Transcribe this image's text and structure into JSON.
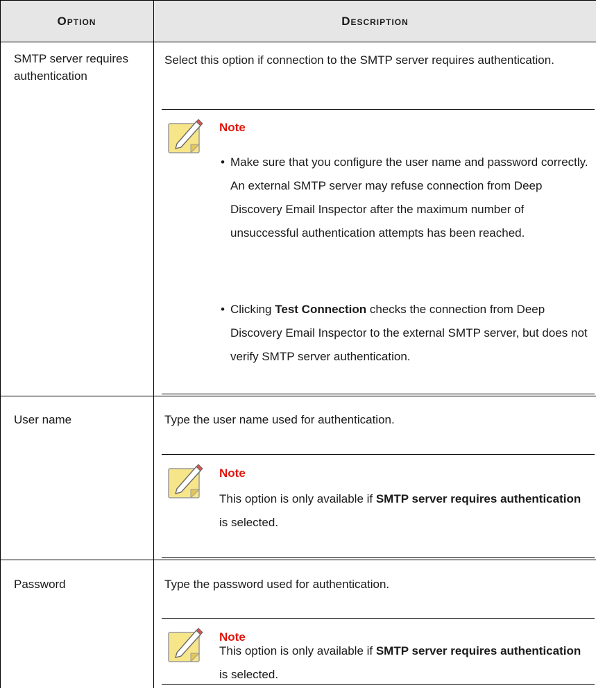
{
  "header": {
    "option": "Option",
    "description": "Description"
  },
  "rows": [
    {
      "option": "SMTP server requires authentication",
      "description": "Select this option if connection to the SMTP server requires authentication.",
      "note": {
        "title": "Note",
        "bullets": [
          {
            "text": "Make sure that you configure the user name and password correctly. An external SMTP server may refuse connection from Deep Discovery Email Inspector after the maximum number of unsuccessful authentication attempts has been reached."
          },
          {
            "pre": "Clicking ",
            "bold": "Test Connection",
            "post": " checks the connection from Deep Discovery Email Inspector to the external SMTP server, but does not verify SMTP server authentication."
          }
        ]
      }
    },
    {
      "option": "User name",
      "description": "Type the user name used for authentication.",
      "note": {
        "title": "Note",
        "pre": "This option is only available if ",
        "bold": "SMTP server requires authentication",
        "post": " is selected."
      }
    },
    {
      "option": "Password",
      "description": "Type the password used for authentication.",
      "note": {
        "title": "Note",
        "pre": "This option is only available if ",
        "bold": "SMTP server requires authentication",
        "post": " is selected."
      }
    }
  ],
  "icons": {
    "note": "note-pencil-icon"
  },
  "colors": {
    "header_bg": "#e6e6e6",
    "note_title": "#e0140a",
    "note_icon_fill": "#f7e58a"
  }
}
